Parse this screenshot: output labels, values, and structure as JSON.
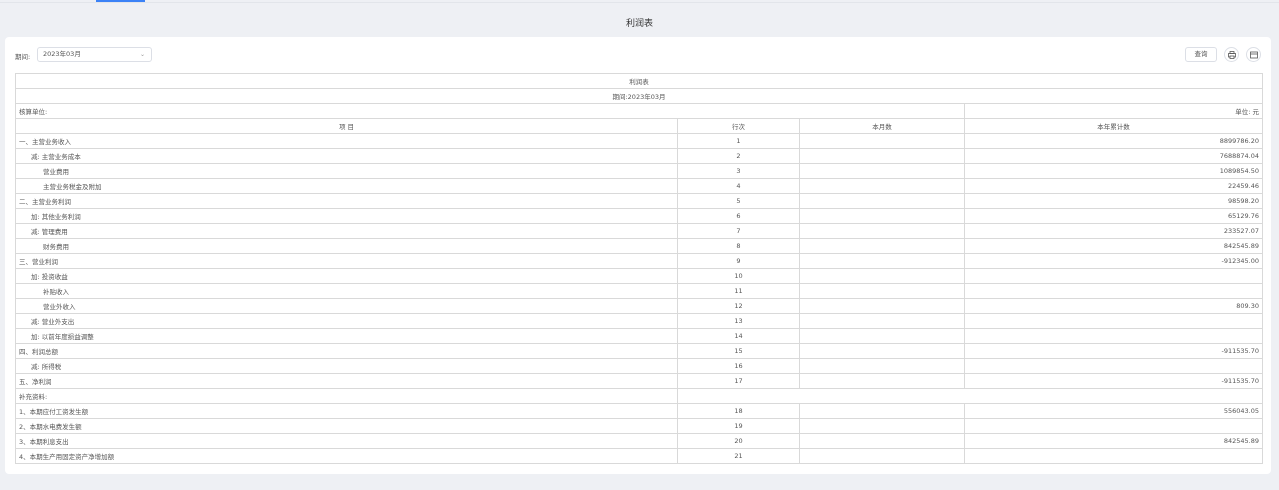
{
  "page_title": "利润表",
  "filter": {
    "label": "期间:",
    "period_value": "2023年03月"
  },
  "toolbar": {
    "query_label": "查询",
    "print_icon": "printer-icon",
    "export_icon": "export-icon"
  },
  "report": {
    "title": "利润表",
    "period_line": "期间:2023年03月",
    "unit_label": "核算单位:",
    "unit_right": "单位: 元",
    "headers": {
      "item": "项  目",
      "line": "行次",
      "month": "本月数",
      "ytd": "本年累计数"
    },
    "rows": [
      {
        "item": "一、主营业务收入",
        "line": "1",
        "month": "",
        "ytd": "8899786.20",
        "indent": 0
      },
      {
        "item": "减: 主营业务成本",
        "line": "2",
        "month": "",
        "ytd": "7688874.04",
        "indent": 1
      },
      {
        "item": "营业费用",
        "line": "3",
        "month": "",
        "ytd": "1089854.50",
        "indent": 2
      },
      {
        "item": "主营业务税金及附加",
        "line": "4",
        "month": "",
        "ytd": "22459.46",
        "indent": 2
      },
      {
        "item": "二、主营业务利润",
        "line": "5",
        "month": "",
        "ytd": "98598.20",
        "indent": 0
      },
      {
        "item": "加: 其他业务利润",
        "line": "6",
        "month": "",
        "ytd": "65129.76",
        "indent": 1
      },
      {
        "item": "减: 管理费用",
        "line": "7",
        "month": "",
        "ytd": "233527.07",
        "indent": 1
      },
      {
        "item": "财务费用",
        "line": "8",
        "month": "",
        "ytd": "842545.89",
        "indent": 2
      },
      {
        "item": "三、营业利润",
        "line": "9",
        "month": "",
        "ytd": "-912345.00",
        "indent": 0
      },
      {
        "item": "加: 投资收益",
        "line": "10",
        "month": "",
        "ytd": "",
        "indent": 1
      },
      {
        "item": "补贴收入",
        "line": "11",
        "month": "",
        "ytd": "",
        "indent": 2
      },
      {
        "item": "营业外收入",
        "line": "12",
        "month": "",
        "ytd": "809.30",
        "indent": 2
      },
      {
        "item": "减: 营业外支出",
        "line": "13",
        "month": "",
        "ytd": "",
        "indent": 1
      },
      {
        "item": "加: 以前年度损益调整",
        "line": "14",
        "month": "",
        "ytd": "",
        "indent": 1
      },
      {
        "item": "四、利润总额",
        "line": "15",
        "month": "",
        "ytd": "-911535.70",
        "indent": 0
      },
      {
        "item": "减: 所得税",
        "line": "16",
        "month": "",
        "ytd": "",
        "indent": 1
      },
      {
        "item": "五、净利润",
        "line": "17",
        "month": "",
        "ytd": "-911535.70",
        "indent": 0
      }
    ],
    "supplement_label": "补充资料:",
    "supplement_rows": [
      {
        "item": "1、本期应付工资发生额",
        "line": "18",
        "month": "",
        "ytd": "556043.05"
      },
      {
        "item": "2、本期水电费发生额",
        "line": "19",
        "month": "",
        "ytd": ""
      },
      {
        "item": "3、本期利息支出",
        "line": "20",
        "month": "",
        "ytd": "842545.89"
      },
      {
        "item": "4、本期生产用固定资产净增加额",
        "line": "21",
        "month": "",
        "ytd": ""
      }
    ]
  }
}
